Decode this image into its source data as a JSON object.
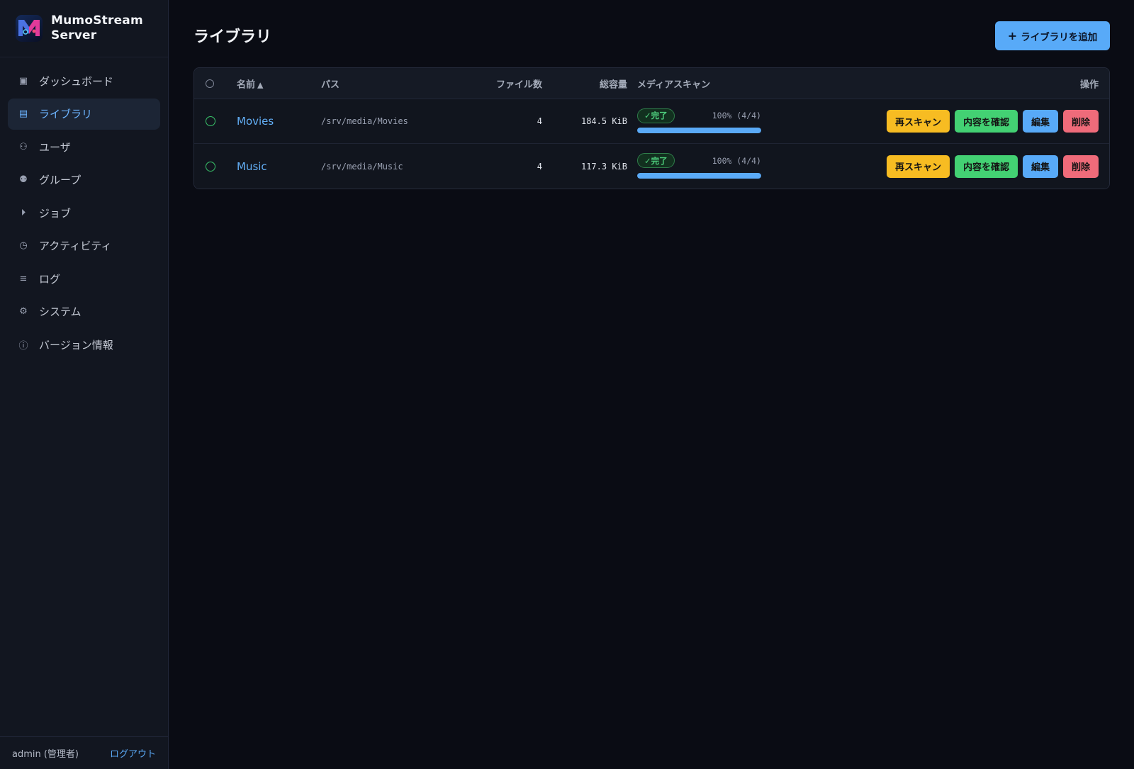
{
  "app": {
    "name": "MumoStream Server"
  },
  "sidebar": {
    "items": [
      {
        "label": "ダッシュボード",
        "icon": "dashboard-icon",
        "glyph": "▣",
        "active": false
      },
      {
        "label": "ライブラリ",
        "icon": "library-icon",
        "glyph": "▤",
        "active": true
      },
      {
        "label": "ユーザ",
        "icon": "user-icon",
        "glyph": "⚇",
        "active": false
      },
      {
        "label": "グループ",
        "icon": "group-icon",
        "glyph": "⚉",
        "active": false
      },
      {
        "label": "ジョブ",
        "icon": "play-icon",
        "glyph": "⏵",
        "active": false
      },
      {
        "label": "アクティビティ",
        "icon": "clock-icon",
        "glyph": "◷",
        "active": false
      },
      {
        "label": "ログ",
        "icon": "list-icon",
        "glyph": "≡",
        "active": false
      },
      {
        "label": "システム",
        "icon": "gear-icon",
        "glyph": "⚙",
        "active": false
      },
      {
        "label": "バージョン情報",
        "icon": "info-icon",
        "glyph": "ⓘ",
        "active": false
      }
    ],
    "footer": {
      "user": "admin (管理者)",
      "logout": "ログアウト"
    }
  },
  "main": {
    "title": "ライブラリ",
    "add_button": "ライブラリを追加",
    "table": {
      "columns": {
        "name": "名前",
        "path": "パス",
        "files": "ファイル数",
        "size": "総容量",
        "scan": "メディアスキャン",
        "actions": "操作"
      },
      "rows": [
        {
          "name": "Movies",
          "path": "/srv/media/Movies",
          "files": "4",
          "size": "184.5 KiB",
          "scan_status": "✓完了",
          "scan_progress": "100% (4/4)",
          "progress_fraction": 1.0
        },
        {
          "name": "Music",
          "path": "/srv/media/Music",
          "files": "4",
          "size": "117.3 KiB",
          "scan_status": "✓完了",
          "scan_progress": "100% (4/4)",
          "progress_fraction": 1.0
        }
      ],
      "actions": {
        "rescan": "再スキャン",
        "view": "内容を確認",
        "edit": "編集",
        "delete": "削除"
      }
    }
  },
  "colors": {
    "accent": "#58aaf8",
    "success": "#43d173",
    "warning": "#f7bc22",
    "danger": "#ef6b7a",
    "background": "#0a0c14"
  }
}
